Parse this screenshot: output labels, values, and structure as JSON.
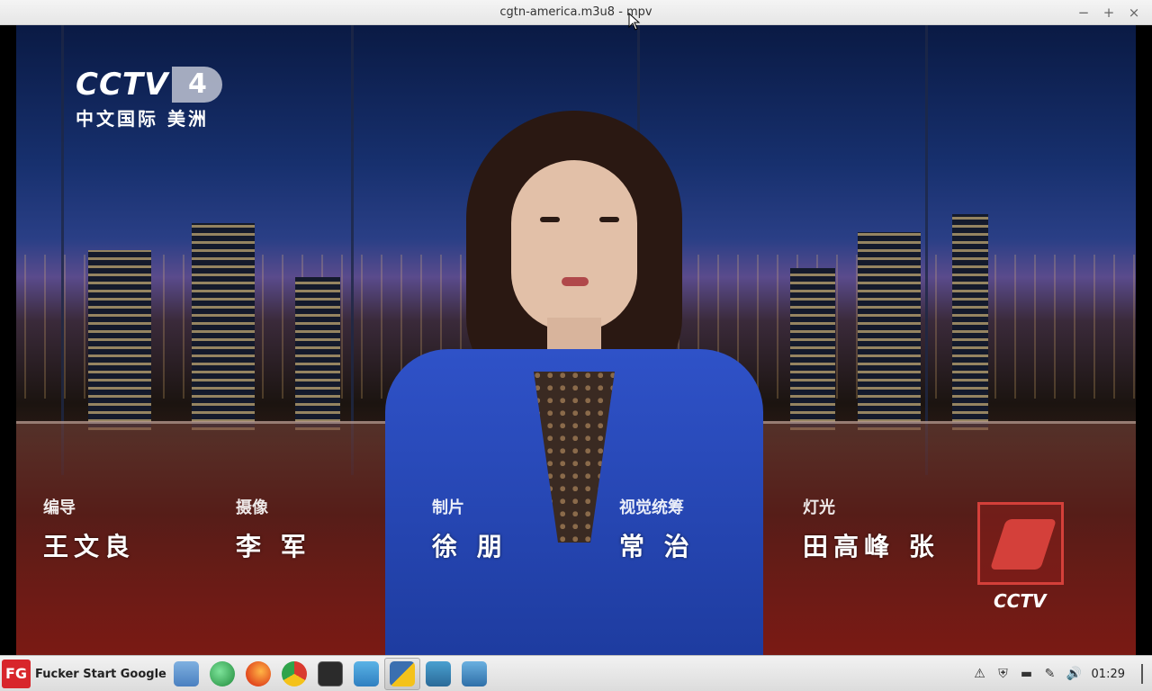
{
  "window": {
    "title": "cgtn-america.m3u8 - mpv",
    "controls": {
      "minimize": "−",
      "maximize": "+",
      "close": "×"
    }
  },
  "video": {
    "channel_logo": {
      "brand": "CCTV",
      "number": "4",
      "subtitle": "中文国际 美洲"
    },
    "credits": [
      {
        "role": "编导",
        "name": "王文良"
      },
      {
        "role": "摄像",
        "name": "李 军"
      },
      {
        "role": "制片",
        "name": "徐 朋"
      },
      {
        "role": "视觉统筹",
        "name": "常 治"
      },
      {
        "role": "灯光",
        "name": "田高峰  张"
      }
    ],
    "corner_logo_text": "CCTV"
  },
  "taskbar": {
    "start_label": "Fucker Start Google",
    "start_icon_text": "FG",
    "apps": [
      {
        "name": "file-manager-icon",
        "color": "#5a8ec8"
      },
      {
        "name": "edge-dev-icon",
        "color": "#2fa34a"
      },
      {
        "name": "firefox-icon",
        "color": "#e66a1e"
      },
      {
        "name": "chrome-icon",
        "color": "#d93a2f"
      },
      {
        "name": "terminal-icon",
        "color": "#2b2b2b"
      },
      {
        "name": "snowflake-icon",
        "color": "#2f8fc8"
      },
      {
        "name": "python-icon",
        "color": "#3a6fb0"
      },
      {
        "name": "system-monitor-icon",
        "color": "#3a8ab8"
      },
      {
        "name": "tool-icon",
        "color": "#3a7ab8"
      }
    ],
    "clock": "01:29"
  }
}
